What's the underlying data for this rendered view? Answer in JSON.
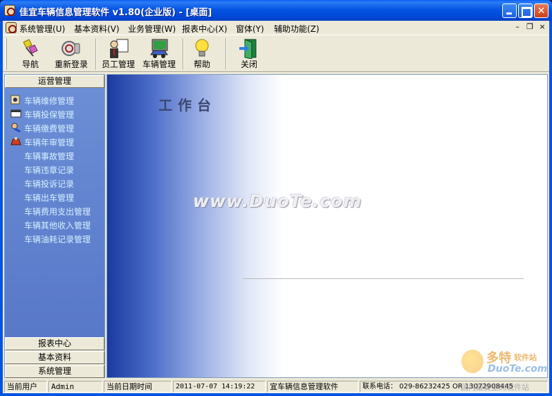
{
  "window": {
    "title": "佳宜车辆信息管理软件 v1.80(企业版)  - [桌面]",
    "controls": {
      "minimize": "min",
      "maximize": "max",
      "close": "close"
    }
  },
  "menubar": {
    "items": [
      {
        "label": "系统管理(U)"
      },
      {
        "label": "基本资料(V)"
      },
      {
        "label": "业务管理(W)"
      },
      {
        "label": "报表中心(X)"
      },
      {
        "label": "窗体(Y)"
      },
      {
        "label": "辅助功能(Z)"
      }
    ],
    "mdi": {
      "minimize": "–",
      "restore": "❐",
      "close": "×"
    }
  },
  "toolbar": {
    "buttons": [
      {
        "label": "导航",
        "icon": "navigation-icon"
      },
      {
        "label": "重新登录",
        "icon": "relogin-icon"
      },
      {
        "label": "员工管理",
        "icon": "staff-icon"
      },
      {
        "label": "车辆管理",
        "icon": "vehicle-icon"
      },
      {
        "label": "帮助",
        "icon": "help-bulb-icon"
      },
      {
        "label": "关闭",
        "icon": "close-door-icon"
      }
    ]
  },
  "sidebar": {
    "top_header": "运营管理",
    "items": [
      {
        "label": "车辆维修管理",
        "icon": "repair-icon"
      },
      {
        "label": "车辆投保管理",
        "icon": "insurance-icon"
      },
      {
        "label": "车辆缴费管理",
        "icon": "payment-icon"
      },
      {
        "label": "车辆年审管理",
        "icon": "annual-review-icon"
      },
      {
        "label": "车辆事故管理"
      },
      {
        "label": "车辆违章记录"
      },
      {
        "label": "车辆投诉记录"
      },
      {
        "label": "车辆出车管理"
      },
      {
        "label": "车辆费用支出管理"
      },
      {
        "label": "车辆其他收入管理"
      },
      {
        "label": "车辆油耗记录管理"
      }
    ],
    "bottom_headers": [
      "报表中心",
      "基本资料",
      "系统管理"
    ]
  },
  "desktop": {
    "title": "工作台",
    "watermark": "www.DuoTe.com",
    "corner_watermark": {
      "line1": "多特",
      "line1b": "软件站",
      "line2": "DuoTe.com"
    }
  },
  "statusbar": {
    "user_label": "当前用户",
    "user_value": "Admin",
    "date_label": "当前日期时间",
    "date_value": "2011-07-07 14:19:22",
    "app_name": "宜车辆信息管理软件",
    "contact": "联系电话：  029-86232425  OR  13072908445",
    "bottom_watermark": "国内最安全的软件站"
  }
}
